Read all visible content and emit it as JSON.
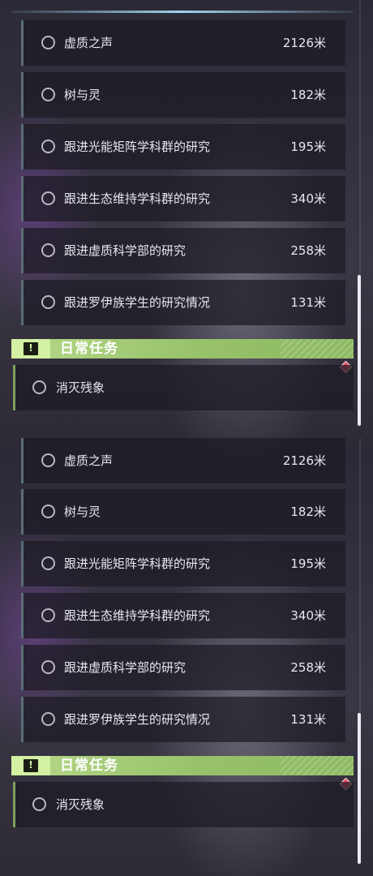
{
  "panels": [
    {
      "quests": [
        {
          "name": "虚质之声",
          "distance": "2126米"
        },
        {
          "name": "树与灵",
          "distance": "182米"
        },
        {
          "name": "跟进光能矩阵学科群的研究",
          "distance": "195米"
        },
        {
          "name": "跟进生态维持学科群的研究",
          "distance": "340米"
        },
        {
          "name": "跟进虚质科学部的研究",
          "distance": "258米"
        },
        {
          "name": "跟进罗伊族学生的研究情况",
          "distance": "131米"
        }
      ],
      "daily": {
        "title": "日常任务",
        "items": [
          {
            "name": "消灭残象"
          }
        ]
      }
    },
    {
      "quests": [
        {
          "name": "虚质之声",
          "distance": "2126米"
        },
        {
          "name": "树与灵",
          "distance": "182米"
        },
        {
          "name": "跟进光能矩阵学科群的研究",
          "distance": "195米"
        },
        {
          "name": "跟进生态维持学科群的研究",
          "distance": "340米"
        },
        {
          "name": "跟进虚质科学部的研究",
          "distance": "258米"
        },
        {
          "name": "跟进罗伊族学生的研究情况",
          "distance": "131米"
        }
      ],
      "daily": {
        "title": "日常任务",
        "items": [
          {
            "name": "消灭残象"
          }
        ]
      }
    }
  ],
  "colors": {
    "daily_accent": "#a8cf7c",
    "marker": "#e25066"
  }
}
